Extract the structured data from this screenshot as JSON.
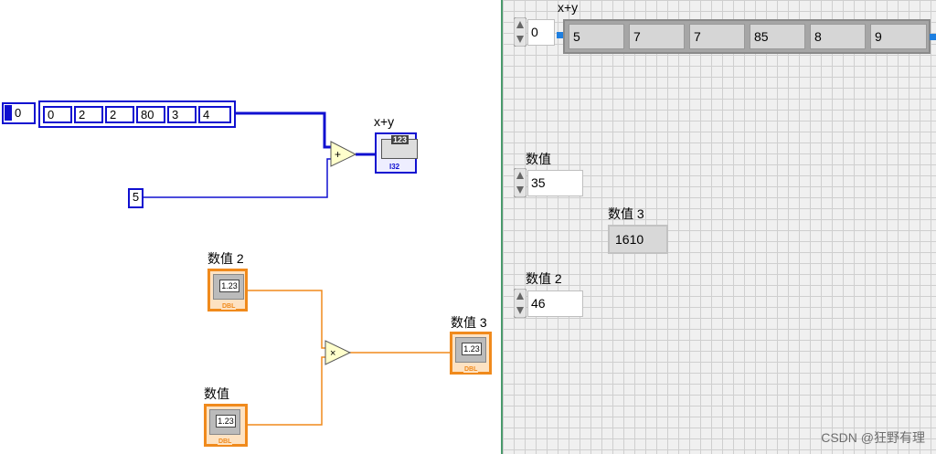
{
  "block_diagram": {
    "array_constant": {
      "index": "0",
      "elements": [
        "0",
        "2",
        "2",
        "80",
        "3",
        "4"
      ]
    },
    "constant_five": "5",
    "add_function": "+",
    "multiply_function": "×",
    "xy_indicator": {
      "label": "x+y",
      "badge": "123",
      "type_tag": "I32"
    },
    "numeric2": {
      "label": "数值 2",
      "display": "1.23",
      "type_tag": "DBL"
    },
    "numeric": {
      "label": "数值",
      "display": "1.23",
      "type_tag": "DBL"
    },
    "numeric3": {
      "label": "数值 3",
      "display": "1.23",
      "type_tag": "DBL"
    },
    "colors": {
      "int_wire": "#1010d0",
      "dbl_wire": "#f08a1c",
      "function_fill": "#ffffcc"
    }
  },
  "front_panel": {
    "xy_array": {
      "label": "x+y",
      "index": "0",
      "elements": [
        "5",
        "7",
        "7",
        "85",
        "8",
        "9"
      ]
    },
    "numeric": {
      "label": "数值",
      "value": "35"
    },
    "numeric3": {
      "label": "数值 3",
      "value": "1610"
    },
    "numeric2": {
      "label": "数值 2",
      "value": "46"
    },
    "grid_color": "#cfcfcf",
    "handle_color": "#1e7fe0"
  },
  "watermark": "CSDN @狂野有理"
}
